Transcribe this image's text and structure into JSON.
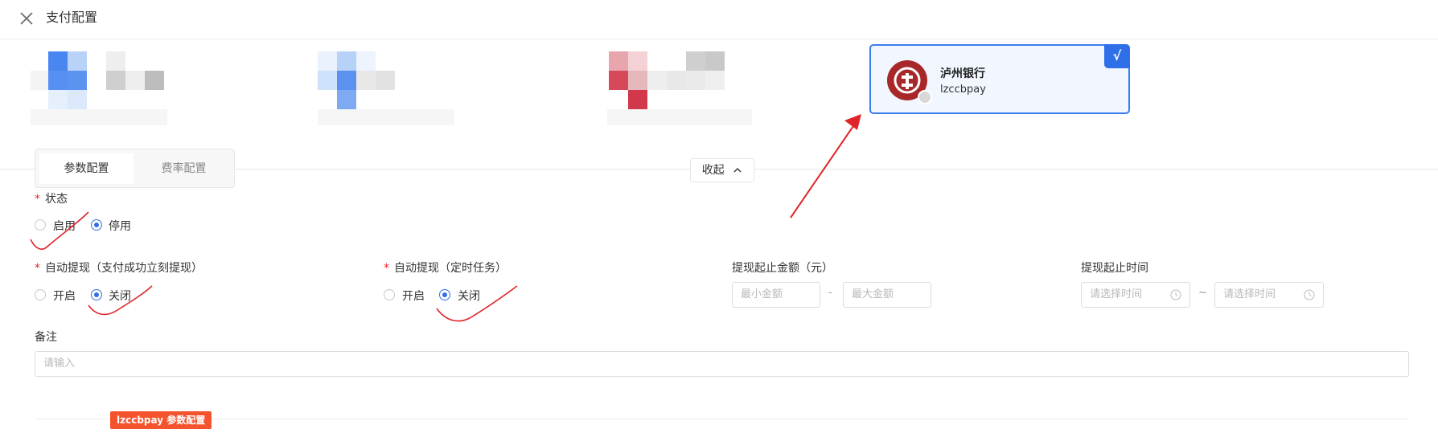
{
  "header": {
    "title": "支付配置"
  },
  "bank_card": {
    "name": "泸州银行",
    "code": "lzccbpay",
    "check": "√"
  },
  "tabs": [
    {
      "label": "参数配置",
      "active": true
    },
    {
      "label": "费率配置",
      "active": false
    }
  ],
  "collapse_label": "收起",
  "form": {
    "status": {
      "label": "状态",
      "required": true,
      "options": [
        "启用",
        "停用"
      ],
      "selected": "停用"
    },
    "auto_withdraw_instant": {
      "label": "自动提现（支付成功立刻提现）",
      "required": true,
      "options": [
        "开启",
        "关闭"
      ],
      "selected": "关闭"
    },
    "auto_withdraw_scheduled": {
      "label": "自动提现（定时任务）",
      "required": true,
      "options": [
        "开启",
        "关闭"
      ],
      "selected": "关闭"
    },
    "amount_range": {
      "label": "提现起止金额（元）",
      "min_placeholder": "最小金额",
      "max_placeholder": "最大金额",
      "separator": "-"
    },
    "time_range": {
      "label": "提现起止时间",
      "start_placeholder": "请选择时间",
      "end_placeholder": "请选择时间",
      "separator": "~"
    },
    "remark": {
      "label": "备注",
      "placeholder": "请输入"
    }
  },
  "section_tag": "lzccbpay 参数配置",
  "colors": {
    "accent": "#2f6fe8",
    "required": "#f5222d",
    "tag": "#f5532d",
    "bank_logo": "#a8282a",
    "annotation": "#e0242a"
  },
  "icons": [
    "close-icon",
    "chevron-up-icon",
    "bank-logo-icon",
    "check-icon",
    "clock-icon"
  ]
}
